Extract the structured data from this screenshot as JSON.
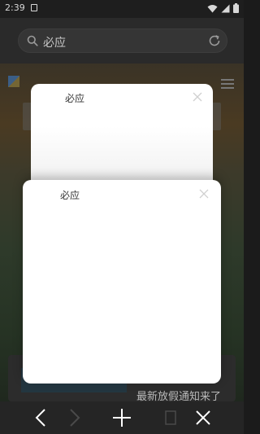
{
  "status_bar": {
    "time": "2:39"
  },
  "toolbar": {
    "search_text": "必应"
  },
  "webpage": {
    "news_title": "最新放假通知来了"
  },
  "tabs": [
    {
      "title": "必应"
    },
    {
      "title": "必应"
    }
  ],
  "colors": {
    "card": "#ffffff",
    "dim_overlay": "#1b1b1b",
    "icon_white": "#ffffff"
  }
}
